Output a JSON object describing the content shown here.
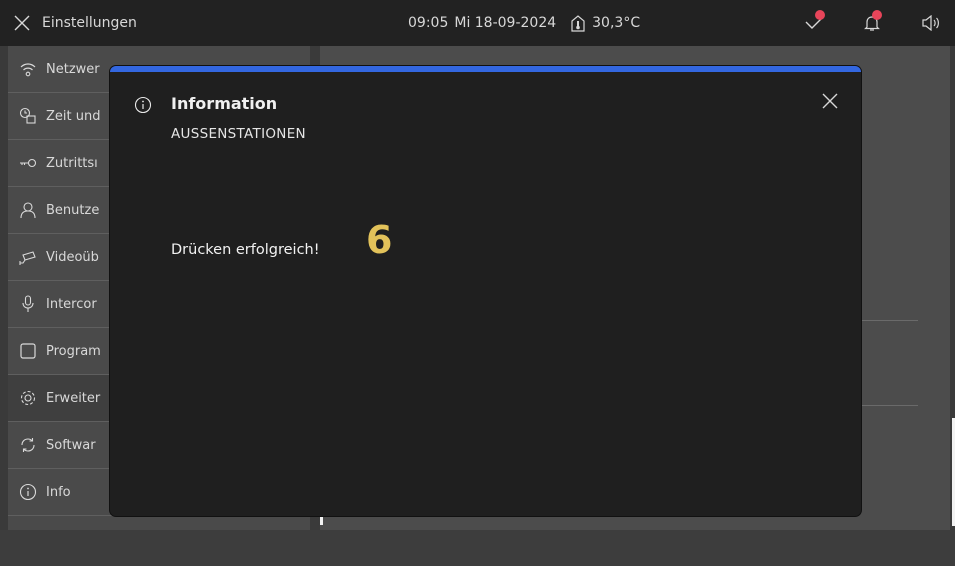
{
  "topbar": {
    "title": "Einstellungen",
    "time": "09:05",
    "date": "Mi 18-09-2024",
    "temperature": "30,3°C"
  },
  "sidebar": {
    "items": [
      {
        "label": "Netzwer",
        "icon": "wifi-icon"
      },
      {
        "label": "Zeit und",
        "icon": "clock-calendar-icon"
      },
      {
        "label": "Zutrittsı",
        "icon": "key-icon"
      },
      {
        "label": "Benutze",
        "icon": "user-icon"
      },
      {
        "label": "Videoüb",
        "icon": "camera-icon"
      },
      {
        "label": "Intercor",
        "icon": "microphone-icon"
      },
      {
        "label": "Program",
        "icon": "square-icon"
      },
      {
        "label": "Erweiter",
        "icon": "gear-icon"
      },
      {
        "label": "Softwar",
        "icon": "refresh-icon"
      },
      {
        "label": "Info",
        "icon": "info-icon"
      }
    ],
    "active_index": 7
  },
  "modal": {
    "title": "Information",
    "subtitle": "AUSSENSTATIONEN",
    "message": "Drücken erfolgreich!",
    "count": "6"
  },
  "colors": {
    "accent_bar": "#3367e0",
    "count_color": "#e2c25a",
    "notification_dot": "#e8455a"
  }
}
